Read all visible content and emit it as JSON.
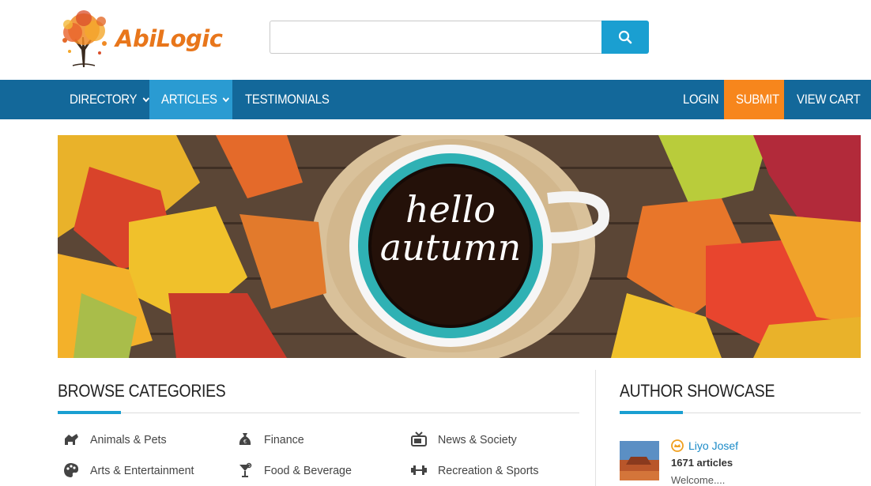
{
  "brand": {
    "name": "AbiLogic",
    "color": "#e8761b"
  },
  "search": {
    "placeholder": "",
    "value": ""
  },
  "nav": {
    "left": [
      {
        "label": "DIRECTORY",
        "has_dropdown": true,
        "active": false
      },
      {
        "label": "ARTICLES",
        "has_dropdown": true,
        "active": true
      },
      {
        "label": "TESTIMONIALS",
        "has_dropdown": false,
        "active": false
      }
    ],
    "right": [
      {
        "label": "LOGIN"
      },
      {
        "label": "SUBMIT",
        "highlight": true
      },
      {
        "label": "VIEW CART"
      }
    ],
    "colors": {
      "bar": "#13689a",
      "active": "#2a9bd2",
      "submit": "#f7861c"
    }
  },
  "hero": {
    "line1": "hello",
    "line2": "autumn"
  },
  "browse": {
    "title": "BROWSE CATEGORIES",
    "categories": [
      {
        "label": "Animals & Pets",
        "icon": "pets-icon"
      },
      {
        "label": "Finance",
        "icon": "money-bag-icon"
      },
      {
        "label": "News & Society",
        "icon": "tv-icon"
      },
      {
        "label": "Arts & Entertainment",
        "icon": "palette-icon"
      },
      {
        "label": "Food & Beverage",
        "icon": "cocktail-icon"
      },
      {
        "label": "Recreation & Sports",
        "icon": "dumbbell-icon"
      }
    ]
  },
  "showcase": {
    "title": "AUTHOR SHOWCASE",
    "author": {
      "name": "Liyo Josef",
      "articles": "1671 articles",
      "bio": "Welcome...."
    }
  }
}
